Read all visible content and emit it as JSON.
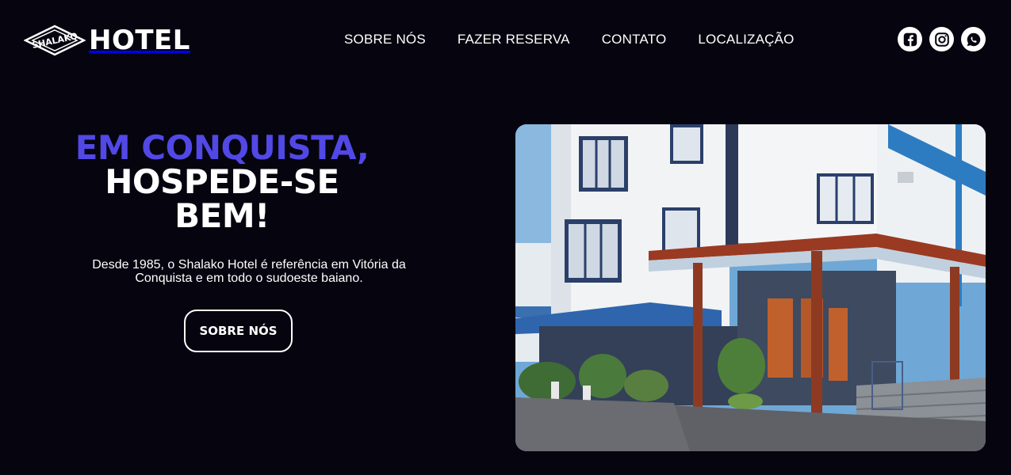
{
  "header": {
    "logo": {
      "mark_text": "SHALAKO",
      "wordmark": "HOTEL"
    },
    "nav": [
      {
        "label": "SOBRE NÓS"
      },
      {
        "label": "FAZER RESERVA"
      },
      {
        "label": "CONTATO"
      },
      {
        "label": "LOCALIZAÇÃO"
      }
    ],
    "social": [
      {
        "icon": "facebook-icon"
      },
      {
        "icon": "instagram-icon"
      },
      {
        "icon": "whatsapp-icon"
      }
    ]
  },
  "hero": {
    "title_accent": "EM CONQUISTA,",
    "title_line2": "HOSPEDE-SE",
    "title_line3": "BEM!",
    "description": "Desde 1985, o Shalako Hotel é referência em Vitória da Conquista e em todo o sudoeste baiano.",
    "button_label": "SOBRE NÓS"
  },
  "image": {
    "subject": "hotel-building-photo"
  },
  "colors": {
    "background": "#06040f",
    "accent": "#5148e6",
    "text": "#ffffff"
  }
}
